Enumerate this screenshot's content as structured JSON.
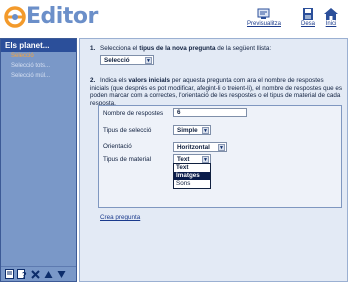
{
  "header": {
    "logo_text": "Editor",
    "tools": [
      {
        "label": "Previsualitza",
        "icon": "preview-icon"
      },
      {
        "label": "Desa",
        "icon": "save-icon"
      },
      {
        "label": "Inici",
        "icon": "home-icon"
      }
    ]
  },
  "sidebar": {
    "title": "Els planet...",
    "items": [
      {
        "label": "Selecció",
        "state": "active"
      },
      {
        "label": "Selecció tots...",
        "state": "dim"
      },
      {
        "label": "Selecció múl...",
        "state": "dim"
      }
    ],
    "toolbar_icons": [
      "new-page-icon",
      "help-icon",
      "delete-icon",
      "move-up-icon",
      "move-down-icon"
    ]
  },
  "main": {
    "q1": {
      "number": "1.",
      "text_before": "Selecciona el ",
      "text_bold": "tipus de la nova pregunta",
      "text_after": " de la següent llista:",
      "select_value": "Selecció"
    },
    "q2": {
      "number": "2.",
      "text_before": "Indica els ",
      "text_bold": "valors inicials",
      "text_after": " per aquesta pregunta com ara el nombre de respostes inicials (que després es pot modificar, afegint-li o treient-li), el nombre de respostes que es poden marcar com a correctes, l'orientació de les respostes o el tipus de material de cada resposta."
    },
    "props": {
      "n_answers_label": "Nombre de respostes",
      "n_answers_value": "6",
      "sel_type_label": "Tipus de selecció",
      "sel_type_value": "Simple",
      "orient_label": "Orientació",
      "orient_value": "Horitzontal",
      "material_label": "Tipus de material",
      "material_value": "Text",
      "material_options": [
        "Text",
        "Imatges",
        "Sons"
      ],
      "material_highlight": 1
    },
    "create_link": "Crea pregunta"
  },
  "colors": {
    "sidebar_bg": "#7a98c8",
    "sidebar_title": "#2b4f9a",
    "main_bg": "#e3eaf5",
    "logo": "#6b8fc9",
    "active_item": "#f7a43a"
  }
}
